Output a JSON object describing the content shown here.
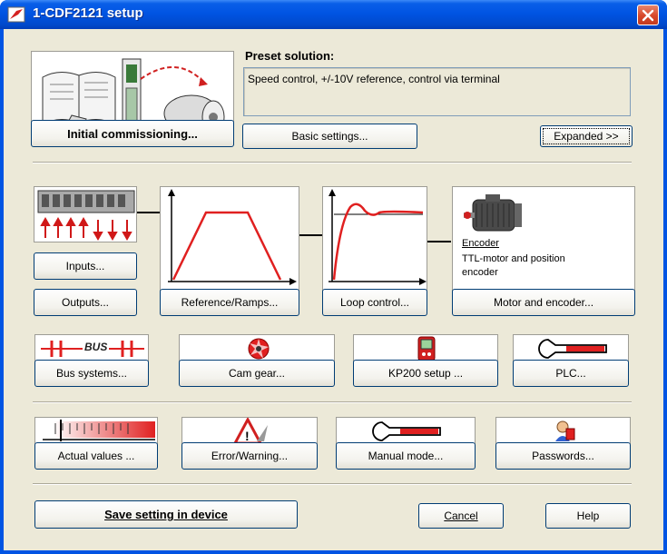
{
  "window": {
    "title": "1-CDF2121 setup"
  },
  "top": {
    "preset_label": "Preset solution:",
    "preset_text": "Speed control, +/-10V reference, control via terminal",
    "initial_commissioning": "Initial commissioning...",
    "basic_settings": "Basic settings...",
    "expanded": "Expanded >>"
  },
  "config": {
    "inputs": "Inputs...",
    "outputs": "Outputs...",
    "reference_ramps": "Reference/Ramps...",
    "loop_control": "Loop control...",
    "motor_encoder": "Motor and encoder...",
    "encoder_title": "Encoder",
    "encoder_desc": "TTL-motor and position encoder"
  },
  "modules": {
    "bus_systems": "Bus systems...",
    "bus_icon_text": "BUS",
    "cam_gear": "Cam gear...",
    "kp200_setup": "KP200 setup ...",
    "plc": "PLC..."
  },
  "tools": {
    "actual_values": "Actual values ...",
    "error_warning": "Error/Warning...",
    "manual_mode": "Manual mode...",
    "passwords": "Passwords..."
  },
  "footer": {
    "save": "Save setting in device",
    "cancel": "Cancel",
    "help": "Help"
  },
  "colors": {
    "titlebar": "#0054e3",
    "dialog_bg": "#ece9d8",
    "accent_red": "#e02020"
  }
}
